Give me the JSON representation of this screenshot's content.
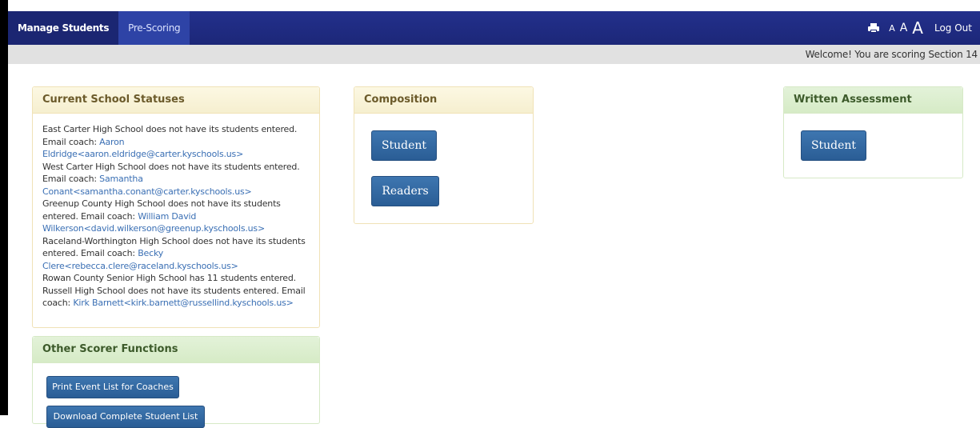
{
  "nav": {
    "tabs": [
      {
        "label": "Manage Students",
        "active": true
      },
      {
        "label": "Pre-Scoring",
        "active": false
      }
    ],
    "font_size_small": "A",
    "font_size_medium": "A",
    "font_size_large": "A",
    "logout_label": "Log Out",
    "print_icon": "printer-icon"
  },
  "welcome_message": "Welcome! You are scoring Section 14",
  "statuses": {
    "title": "Current School Statuses",
    "entries": [
      {
        "text": "East Carter High School does not have its students entered. Email coach: ",
        "link": "Aaron Eldridge<aaron.eldridge@carter.kyschools.us>"
      },
      {
        "text": "West Carter High School does not have its students entered. Email coach: ",
        "link": "Samantha Conant<samantha.conant@carter.kyschools.us>"
      },
      {
        "text": "Greenup County High School does not have its students entered. Email coach: ",
        "link": "William David Wilkerson<david.wilkerson@greenup.kyschools.us>"
      },
      {
        "text": "Raceland-Worthington High School does not have its students entered. Email coach: ",
        "link": "Becky Clere<rebecca.clere@raceland.kyschools.us>"
      },
      {
        "text": "Rowan County Senior High School has 11 students entered.",
        "link": ""
      },
      {
        "text": "Russell High School does not have its students entered. Email coach: ",
        "link": "Kirk Barnett<kirk.barnett@russellind.kyschools.us>"
      }
    ]
  },
  "other": {
    "title": "Other Scorer Functions",
    "print_button": "Print Event List for Coaches",
    "download_button": "Download Complete Student List"
  },
  "composition": {
    "title": "Composition",
    "student_ids_button": "Student IDs",
    "readers_button": "Readers"
  },
  "written": {
    "title": "Written Assessment",
    "student_ids_button": "Student IDs"
  },
  "colors": {
    "navbar": "#1c2778",
    "button": "#2a5d95",
    "link": "#3a6fb4"
  }
}
